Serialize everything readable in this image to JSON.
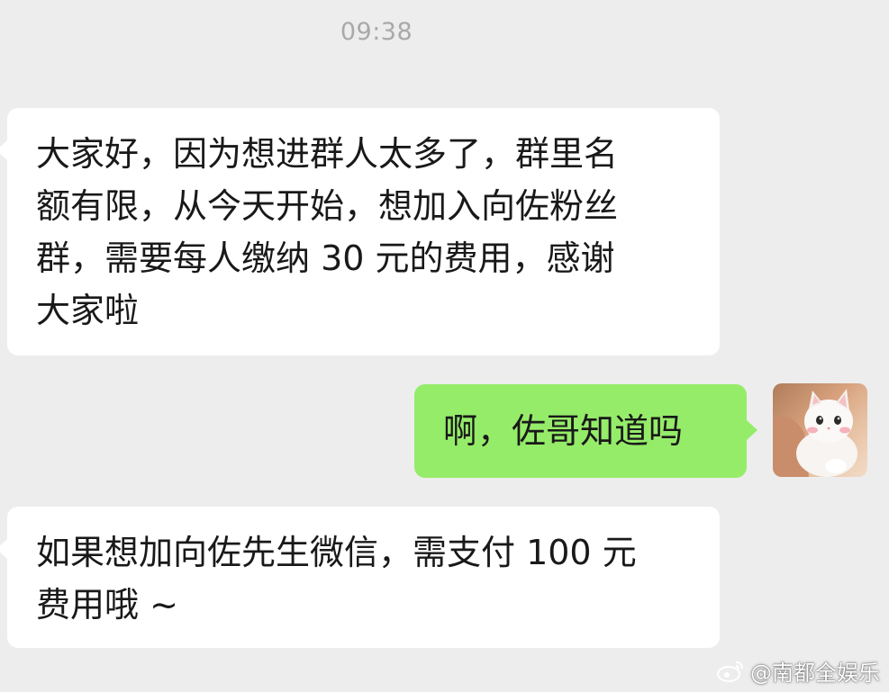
{
  "chat": {
    "timestamp": "09:38",
    "messages": [
      {
        "side": "left",
        "lines": [
          "大家好，因为想进群人太多了，群里名",
          "额有限，从今天开始，想加入向佐粉丝",
          "群，需要每人缴纳 30 元的费用，感谢",
          "大家啦"
        ]
      },
      {
        "side": "right",
        "lines": [
          "啊，佐哥知道吗"
        ]
      },
      {
        "side": "left",
        "lines": [
          "如果想加向佐先生微信，需支付 100 元",
          "费用哦 ~"
        ]
      }
    ]
  },
  "avatar": {
    "icon": "cat-photo-avatar"
  },
  "watermark": {
    "text": "@南都全娱乐",
    "icon": "weibo-icon"
  },
  "colors": {
    "background": "#ededed",
    "incoming_bubble": "#ffffff",
    "outgoing_bubble": "#95ec69",
    "timestamp": "#a9a9a9",
    "text": "#191919"
  }
}
